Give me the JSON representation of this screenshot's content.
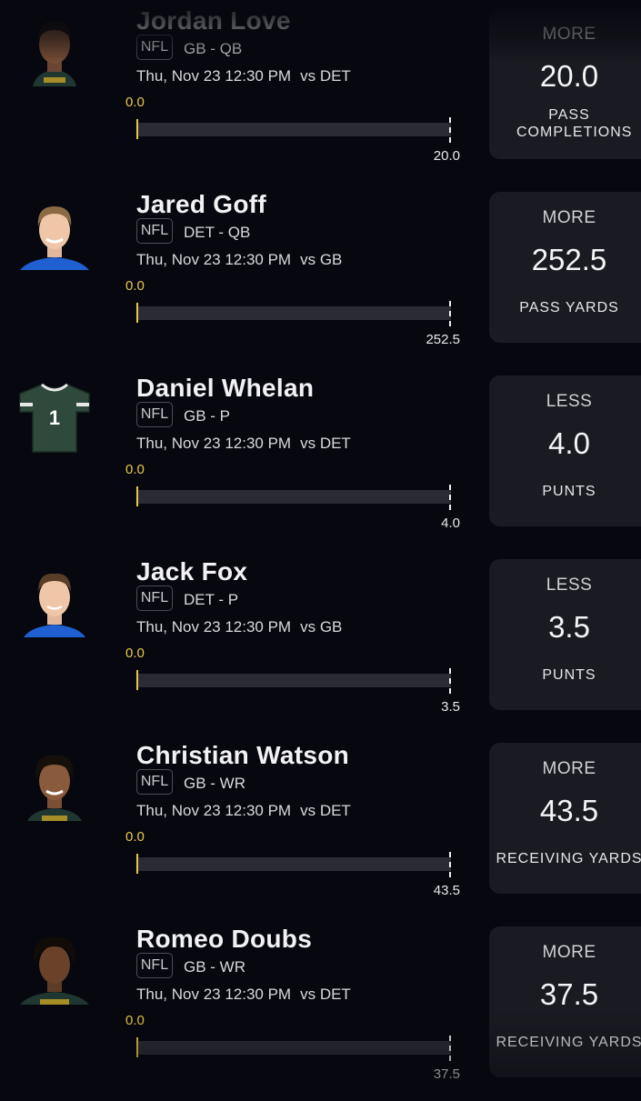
{
  "picks": [
    {
      "player": "Jordan Love",
      "league": "NFL",
      "team_pos": "GB - QB",
      "game_time": "Thu, Nov 23 12:30 PM",
      "opponent": "vs DET",
      "progress_start": "0.0",
      "line": "20.0",
      "current_value": 0.0,
      "direction": "MORE",
      "stat": "PASS COMPLETIONS",
      "avatar": "player-photo-green-gold"
    },
    {
      "player": "Jared Goff",
      "league": "NFL",
      "team_pos": "DET - QB",
      "game_time": "Thu, Nov 23 12:30 PM",
      "opponent": "vs GB",
      "progress_start": "0.0",
      "line": "252.5",
      "current_value": 0.0,
      "direction": "MORE",
      "stat": "PASS YARDS",
      "avatar": "player-photo-blue"
    },
    {
      "player": "Daniel Whelan",
      "league": "NFL",
      "team_pos": "GB - P",
      "game_time": "Thu, Nov 23 12:30 PM",
      "opponent": "vs DET",
      "progress_start": "0.0",
      "line": "4.0",
      "current_value": 0.0,
      "direction": "LESS",
      "stat": "PUNTS",
      "avatar": "jersey-icon",
      "jersey_number": "1"
    },
    {
      "player": "Jack Fox",
      "league": "NFL",
      "team_pos": "DET - P",
      "game_time": "Thu, Nov 23 12:30 PM",
      "opponent": "vs GB",
      "progress_start": "0.0",
      "line": "3.5",
      "current_value": 0.0,
      "direction": "LESS",
      "stat": "PUNTS",
      "avatar": "player-photo-blue"
    },
    {
      "player": "Christian Watson",
      "league": "NFL",
      "team_pos": "GB - WR",
      "game_time": "Thu, Nov 23 12:30 PM",
      "opponent": "vs DET",
      "progress_start": "0.0",
      "line": "43.5",
      "current_value": 0.0,
      "direction": "MORE",
      "stat": "RECEIVING YARDS",
      "avatar": "player-photo-green-gold"
    },
    {
      "player": "Romeo Doubs",
      "league": "NFL",
      "team_pos": "GB - WR",
      "game_time": "Thu, Nov 23 12:30 PM",
      "opponent": "vs DET",
      "progress_start": "0.0",
      "line": "37.5",
      "current_value": 0.0,
      "direction": "MORE",
      "stat": "RECEIVING YARDS",
      "avatar": "player-photo-green-gold"
    }
  ],
  "colors": {
    "background": "#07080f",
    "card": "#1a1b22",
    "progress_start": "#e6c84a",
    "track": "#2a2b33",
    "packers_green": "#203731",
    "packers_gold": "#c9a227",
    "lions_blue": "#1f5fd1",
    "jersey_green": "#2f4a3c"
  }
}
